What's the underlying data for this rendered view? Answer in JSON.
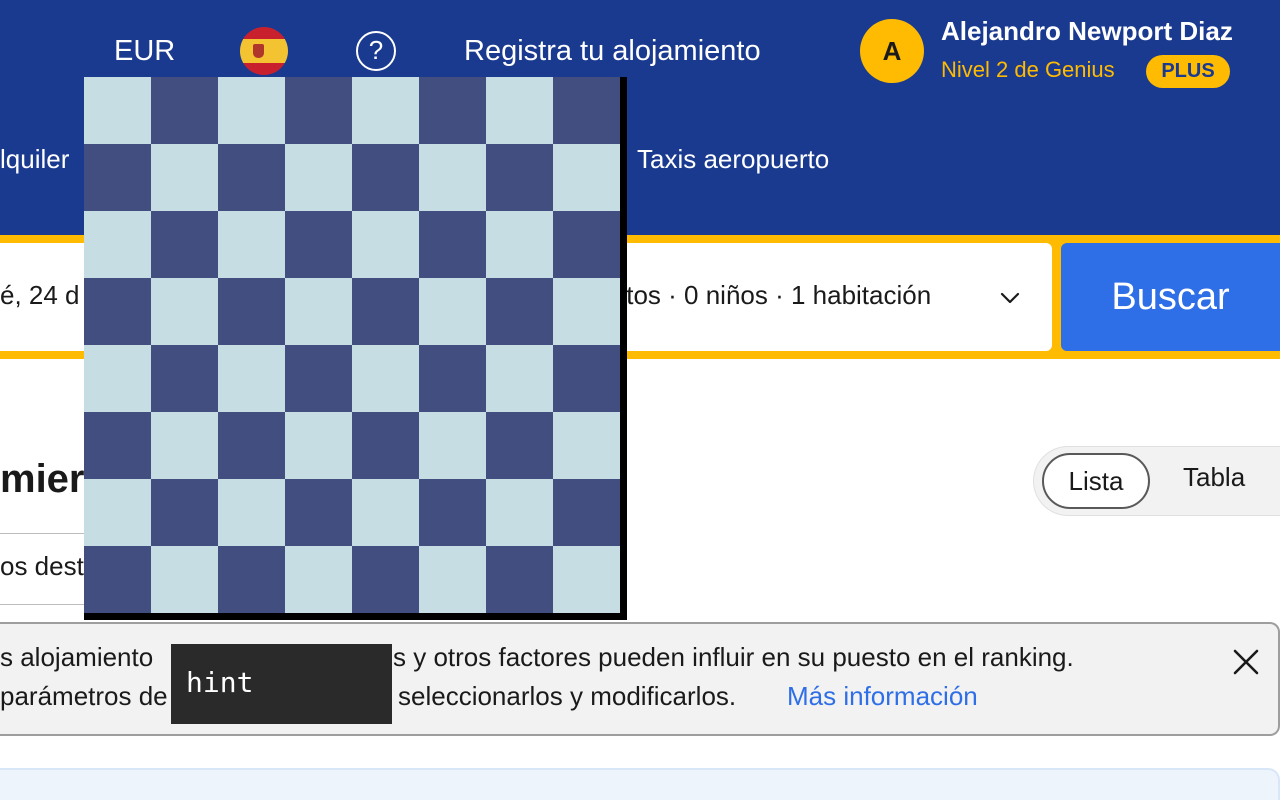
{
  "header": {
    "currency": "EUR",
    "flag_icon": "spain-flag-icon",
    "help_icon": "question-circle-icon",
    "help_glyph": "?",
    "list_property": "Registra tu alojamiento",
    "user": {
      "avatar_letter": "A",
      "name": "Alejandro Newport Diaz",
      "genius_level": "Nivel 2 de Genius",
      "plus_badge": "PLUS"
    },
    "nav": {
      "rental": "lquiler",
      "taxis": "Taxis aeropuerto"
    },
    "colors": {
      "background": "#1a3a8f",
      "accent": "#febb02"
    }
  },
  "search": {
    "dates_value": "é, 24 d",
    "guests_value": "ultos · 0 niños · 1 habitación",
    "chevron_icon": "chevron-down-icon",
    "button_label": "Buscar",
    "button_color": "#2e6ee6"
  },
  "results": {
    "title": "mier",
    "sort_label": "os dest",
    "view_toggle": {
      "list": "Lista",
      "table": "Tabla",
      "selected": "Lista"
    }
  },
  "info_banner": {
    "line1_a": "s alojamiento",
    "line1_b": "s y otros factores pueden influir en su puesto en el ranking.",
    "line2_a": "parámetros de",
    "line2_b": "seleccionarlos y modificarlos.",
    "link_label": "Más información",
    "close_icon": "close-icon"
  },
  "overlays": {
    "checkerboard": {
      "rows": 8,
      "cols": 8,
      "color_light": "#c5dde3",
      "color_dark": "#434e80"
    },
    "hint": "hint"
  }
}
